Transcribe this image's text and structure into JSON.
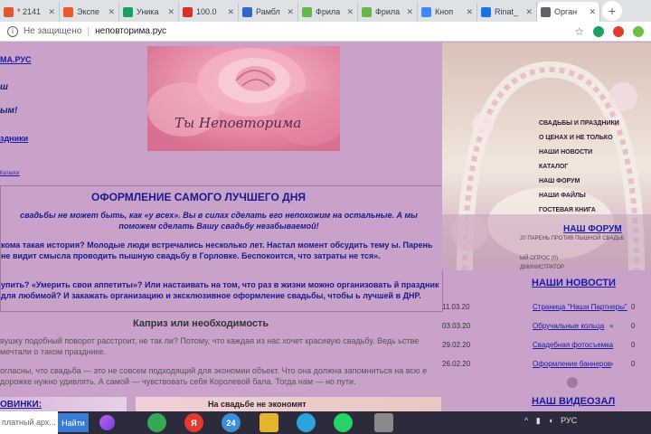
{
  "browser": {
    "tabs": [
      {
        "label": "* 2141",
        "color": "#e2572e",
        "icon": "mail-icon"
      },
      {
        "label": "Экспе",
        "color": "#f05a28",
        "icon": "flame-icon"
      },
      {
        "label": "Уника",
        "color": "#1aa260",
        "icon": "sheets-icon"
      },
      {
        "label": "100.0",
        "color": "#d93025",
        "icon": "circle-c-icon"
      },
      {
        "label": "Рамбл",
        "color": "#3366cc",
        "icon": "rambler-icon"
      },
      {
        "label": "Фрила",
        "color": "#65b74a",
        "icon": "leaf-icon"
      },
      {
        "label": "Фрила",
        "color": "#65b74a",
        "icon": "leaf-icon"
      },
      {
        "label": "Кноп",
        "color": "#4285f4",
        "icon": "drive-icon"
      },
      {
        "label": "Rinat_",
        "color": "#1a73e8",
        "icon": "doc-icon"
      },
      {
        "label": "Орган",
        "color": "#5f6368",
        "icon": "globe-icon",
        "active": true
      }
    ],
    "security_label": "Не защищено",
    "url": "неповторима.рус"
  },
  "left": {
    "site_title": "МА.РУС",
    "slogan1": "ш",
    "slogan2": "ым!",
    "link": "здники",
    "small_link": "Каталог"
  },
  "banner": {
    "script_text": "Ты Неповторима"
  },
  "main": {
    "heading": "ОФОРМЛЕНИЕ САМОГО ЛУЧШЕГО ДНЯ",
    "intro": "свадьбы не может быть, как «у всех». Вы в силах сделать его непохожим на остальные. А мы поможем сделать Вашу свадьбу незабываемой!",
    "story": "кома такая история? Молодые люди встречались несколько лет. Настал момент обсудить тему ы. Парень не видит смысла проводить пышную свадьбу в Горловке. Беспокоится, что затраты не тся».",
    "offer": "упить? «Умерить свои аппетиты»? Или настаивать на том, что раз в жизни можно организовать й праздник для любимой? И закажать организацию и эксклюзивное оформление свадьбы, чтобы ь лучшей в ДНР."
  },
  "article": {
    "heading": "Каприз или необходимость",
    "p1": "вушку подобный поворот расстроит, не так ли? Потому, что каждая из нас хочет красивую свадьбу. Ведь ьстве мечтали о таком празднике.",
    "p2": "огласны, что свадьба — это не совсем подходящий для экономии объект. Что она должна запомниться на всю е дорожке нужно удивлять. А самой — чувствовать себя Королевой бала. Тогда нам — но пути."
  },
  "bottom": {
    "novinki": "ОВИНКИ:",
    "econ": "На свадьбе не экономят"
  },
  "right": {
    "menu": [
      "СВАДЬБЫ И ПРАЗДНИКИ",
      "О ЦЕНАХ И НЕ ТОЛЬКО",
      "НАШИ НОВОСТИ",
      "КАТАЛОГ",
      "НАШ ФОРУМ",
      "НАШИ ФАЙЛЫ",
      "ГОСТЕВАЯ КНИГА"
    ],
    "forum_title": "НАШ ФОРУМ",
    "forum_line1": "20 ПАРЕНЬ ПРОТИВ ПЫШНОЙ СВАДЬБ",
    "forum_line2": "ЫЙ ОПРОС (0)",
    "forum_line3": "ДМИНИСТРАТОР",
    "news_title": "НАШИ НОВОСТИ",
    "news": [
      {
        "date": "11.03.20",
        "title": "Страница \"Наши Партнеры\"",
        "count": "0"
      },
      {
        "date": "03.03.20",
        "title": "Обручальные кольца",
        "count": "0"
      },
      {
        "date": "29.02.20",
        "title": "Свадебная фотосъемка",
        "count": "0"
      },
      {
        "date": "26.02.20",
        "title": "Оформление баннеров",
        "count": "0"
      }
    ],
    "video_title": "НАШ ВИДЕОЗАЛ"
  },
  "taskbar": {
    "search_placeholder": "платный арх...",
    "search_button": "Найти",
    "apps": [
      {
        "name": "chrome-icon",
        "color": "#34a853",
        "label": ""
      },
      {
        "name": "yandex-browser-icon",
        "color": "#e23b2e",
        "label": "Я"
      },
      {
        "name": "calendar-icon",
        "color": "#3b8fd8",
        "label": "24"
      },
      {
        "name": "folder-icon",
        "color": "#e6b32d",
        "label": ""
      },
      {
        "name": "telegram-icon",
        "color": "#2aa3de",
        "label": ""
      },
      {
        "name": "whatsapp-icon",
        "color": "#25d366",
        "label": ""
      },
      {
        "name": "notes-icon",
        "color": "#8a8a8a",
        "label": ""
      }
    ],
    "tray_lang": "РУС"
  }
}
